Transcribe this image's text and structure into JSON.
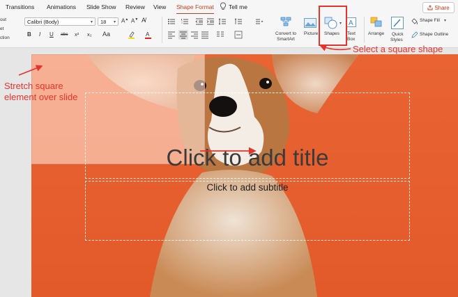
{
  "tabs": [
    "Transitions",
    "Animations",
    "Slide Show",
    "Review",
    "View",
    "Shape Format",
    "Tell me"
  ],
  "active_tab": "Shape Format",
  "share_label": "Share",
  "left_cut_labels": [
    "out",
    "et",
    "ction"
  ],
  "font": {
    "family": "Calibri (Body)",
    "size": "18"
  },
  "format_buttons": [
    "B",
    "I",
    "U",
    "abc",
    "x²",
    "x₂"
  ],
  "big_buttons": [
    {
      "label": "Convert to",
      "label2": "SmartArt",
      "icon": "convert-smartart-icon"
    },
    {
      "label": "Picture",
      "icon": "picture-icon"
    },
    {
      "label": "Shapes",
      "icon": "shapes-icon"
    },
    {
      "label": "Text",
      "label2": "Box",
      "icon": "text-box-icon"
    },
    {
      "label": "Arrange",
      "icon": "arrange-icon"
    },
    {
      "label": "Quick",
      "label2": "Styles",
      "icon": "quick-styles-icon"
    }
  ],
  "shape_fill_label": "Shape Fill",
  "shape_outline_label": "Shape Outline",
  "slide": {
    "title_placeholder": "Click to add title",
    "subtitle_placeholder": "Click to add subtitle"
  },
  "annotations": {
    "select_shape": "Select a square shape",
    "stretch_line1": "Stretch square",
    "stretch_line2": "element over slide"
  },
  "colors": {
    "accent": "#c43e1c",
    "annotation": "#e8332a",
    "slide_background": "#e75f2e"
  }
}
